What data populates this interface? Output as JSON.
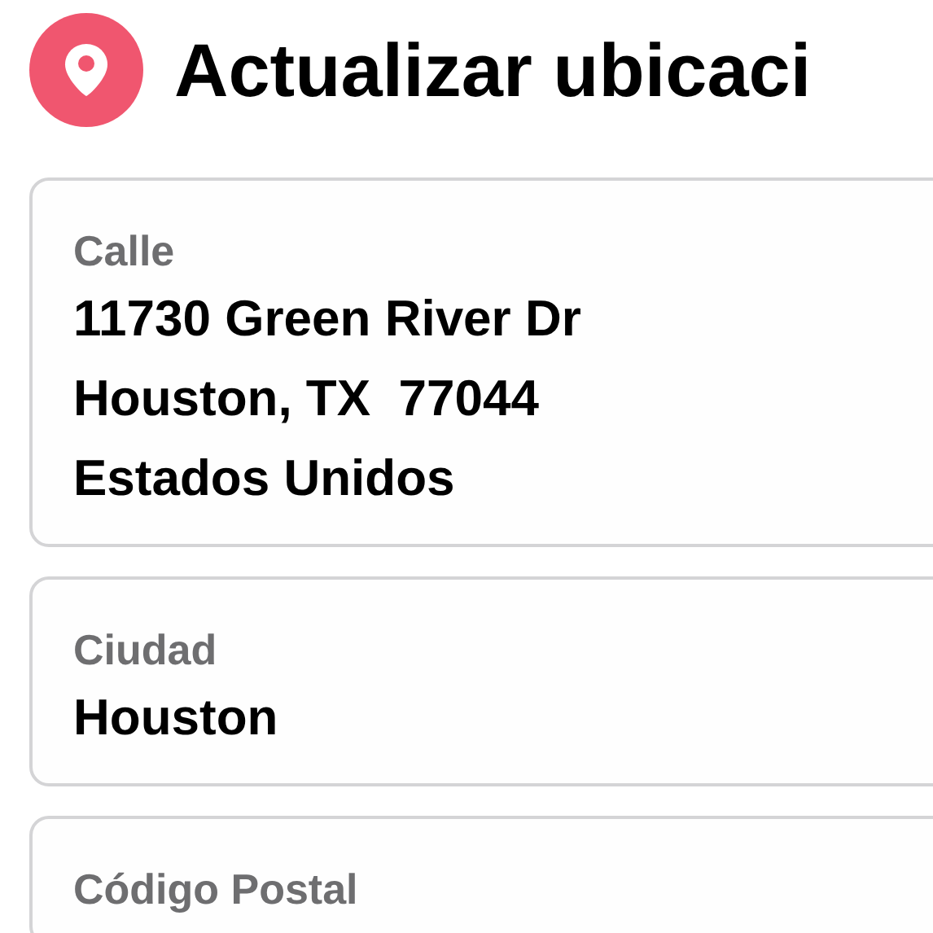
{
  "header": {
    "title": "Actualizar ubicaci"
  },
  "fields": [
    {
      "label": "Calle",
      "lines": [
        "11730 Green River Dr",
        "Houston, TX  77044",
        "Estados Unidos"
      ]
    },
    {
      "label": "Ciudad",
      "lines": [
        "Houston"
      ]
    },
    {
      "label": "Código Postal"
    }
  ]
}
